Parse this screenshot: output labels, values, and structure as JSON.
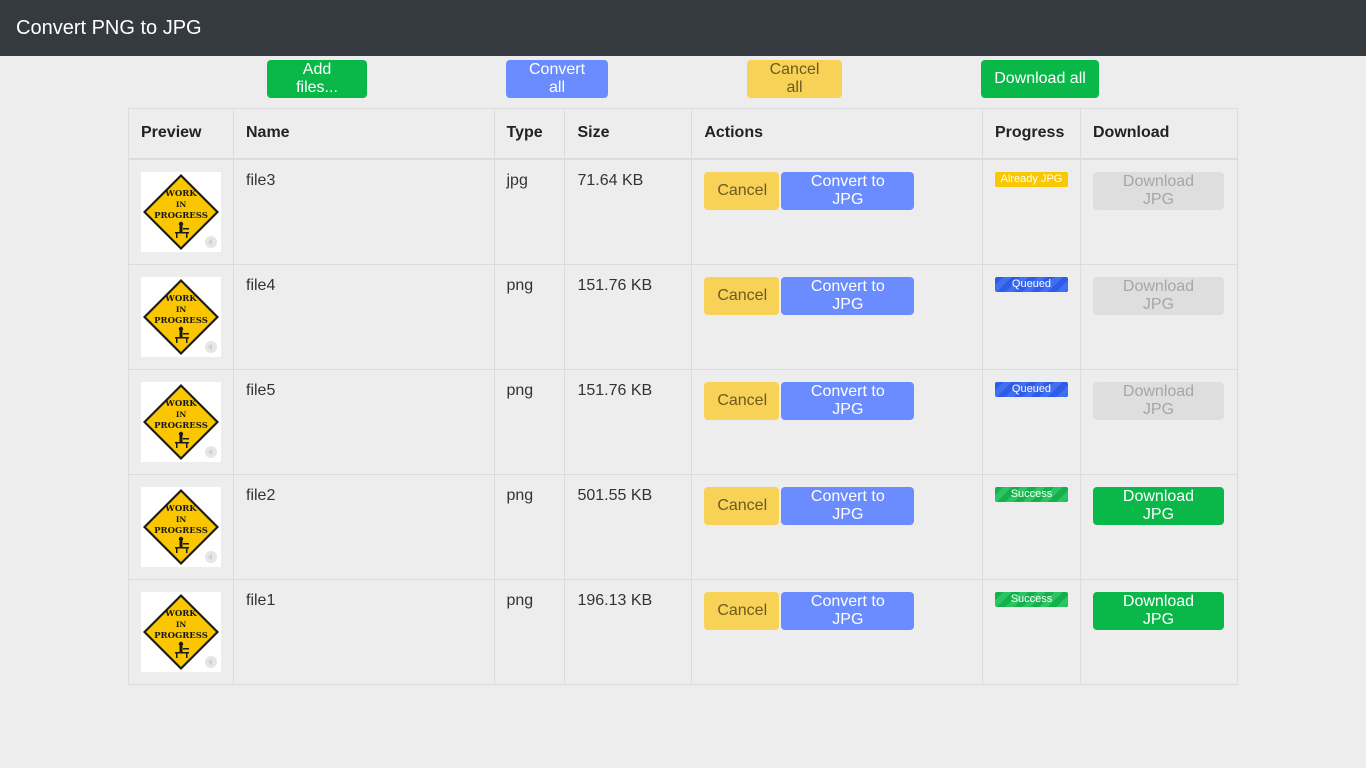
{
  "app": {
    "title": "Convert PNG to JPG"
  },
  "toolbar": {
    "add_files": "Add files...",
    "convert_all": "Convert all",
    "cancel_all": "Cancel all",
    "download_all": "Download all"
  },
  "table": {
    "headers": {
      "preview": "Preview",
      "name": "Name",
      "type": "Type",
      "size": "Size",
      "actions": "Actions",
      "progress": "Progress",
      "download": "Download"
    },
    "rows": [
      {
        "name": "file3",
        "type": "jpg",
        "size": "71.64 KB",
        "cancel": "Cancel",
        "convert": "Convert to JPG",
        "status": "Already JPG",
        "status_kind": "warning",
        "download": "Download JPG",
        "download_enabled": false,
        "preview_icon": "work-in-progress-sign-icon"
      },
      {
        "name": "file4",
        "type": "png",
        "size": "151.76 KB",
        "cancel": "Cancel",
        "convert": "Convert to JPG",
        "status": "Queued",
        "status_kind": "queued",
        "download": "Download JPG",
        "download_enabled": false,
        "preview_icon": "work-in-progress-sign-icon"
      },
      {
        "name": "file5",
        "type": "png",
        "size": "151.76 KB",
        "cancel": "Cancel",
        "convert": "Convert to JPG",
        "status": "Queued",
        "status_kind": "queued",
        "download": "Download JPG",
        "download_enabled": false,
        "preview_icon": "work-in-progress-sign-icon"
      },
      {
        "name": "file2",
        "type": "png",
        "size": "501.55 KB",
        "cancel": "Cancel",
        "convert": "Convert to JPG",
        "status": "Success",
        "status_kind": "success",
        "download": "Download JPG",
        "download_enabled": true,
        "preview_icon": "work-in-progress-sign-icon"
      },
      {
        "name": "file1",
        "type": "png",
        "size": "196.13 KB",
        "cancel": "Cancel",
        "convert": "Convert to JPG",
        "status": "Success",
        "status_kind": "success",
        "download": "Download JPG",
        "download_enabled": true,
        "preview_icon": "work-in-progress-sign-icon"
      }
    ]
  },
  "preview_sign_text": [
    "WORK",
    "IN",
    "PROGRESS"
  ],
  "colors": {
    "navbar": "#343a40",
    "success": "#0ab84a",
    "primary": "#6a8cff",
    "warning": "#f8d257",
    "queued": "#2f5be8",
    "sign_yellow": "#f9c600"
  }
}
